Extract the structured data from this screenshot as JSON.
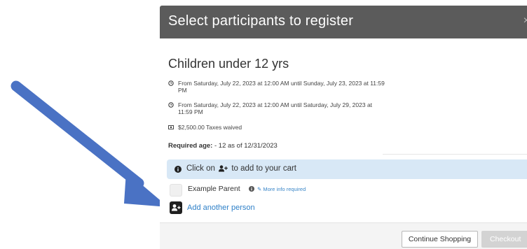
{
  "modal": {
    "title": "Select participants to register",
    "close_icon": "close-icon"
  },
  "event": {
    "title": "Children under 12 yrs",
    "details": [
      {
        "icon": "clock-icon",
        "text": "From Saturday, July 22, 2023 at 12:00 AM until Sunday, July 23, 2023 at 11:59 PM"
      },
      {
        "icon": "clock-icon",
        "text": "From Saturday, July 22, 2023 at 12:00 AM until Saturday, July 29, 2023 at 11:59 PM"
      },
      {
        "icon": "money-icon",
        "text": "$2,500.00 Taxes waived"
      }
    ],
    "required_age_label": "Required age:",
    "required_age_value": " - 12 as of 12/31/2023"
  },
  "banner": {
    "prefix": "Click on",
    "suffix": "to add to your cart",
    "icon": "info-circle-icon"
  },
  "participants": [
    {
      "name": "Example Parent",
      "link": "More info required",
      "icon": "info-icon"
    }
  ],
  "add_person": {
    "label": "Add another person",
    "icon": "add-person-icon"
  },
  "footer": {
    "continue_label": "Continue Shopping",
    "checkout_label": "Checkout"
  },
  "colors": {
    "header_bg": "#5b5b5b",
    "banner_bg": "#d8e8f6",
    "link": "#2f80c8",
    "arrow": "#4a72c4"
  }
}
